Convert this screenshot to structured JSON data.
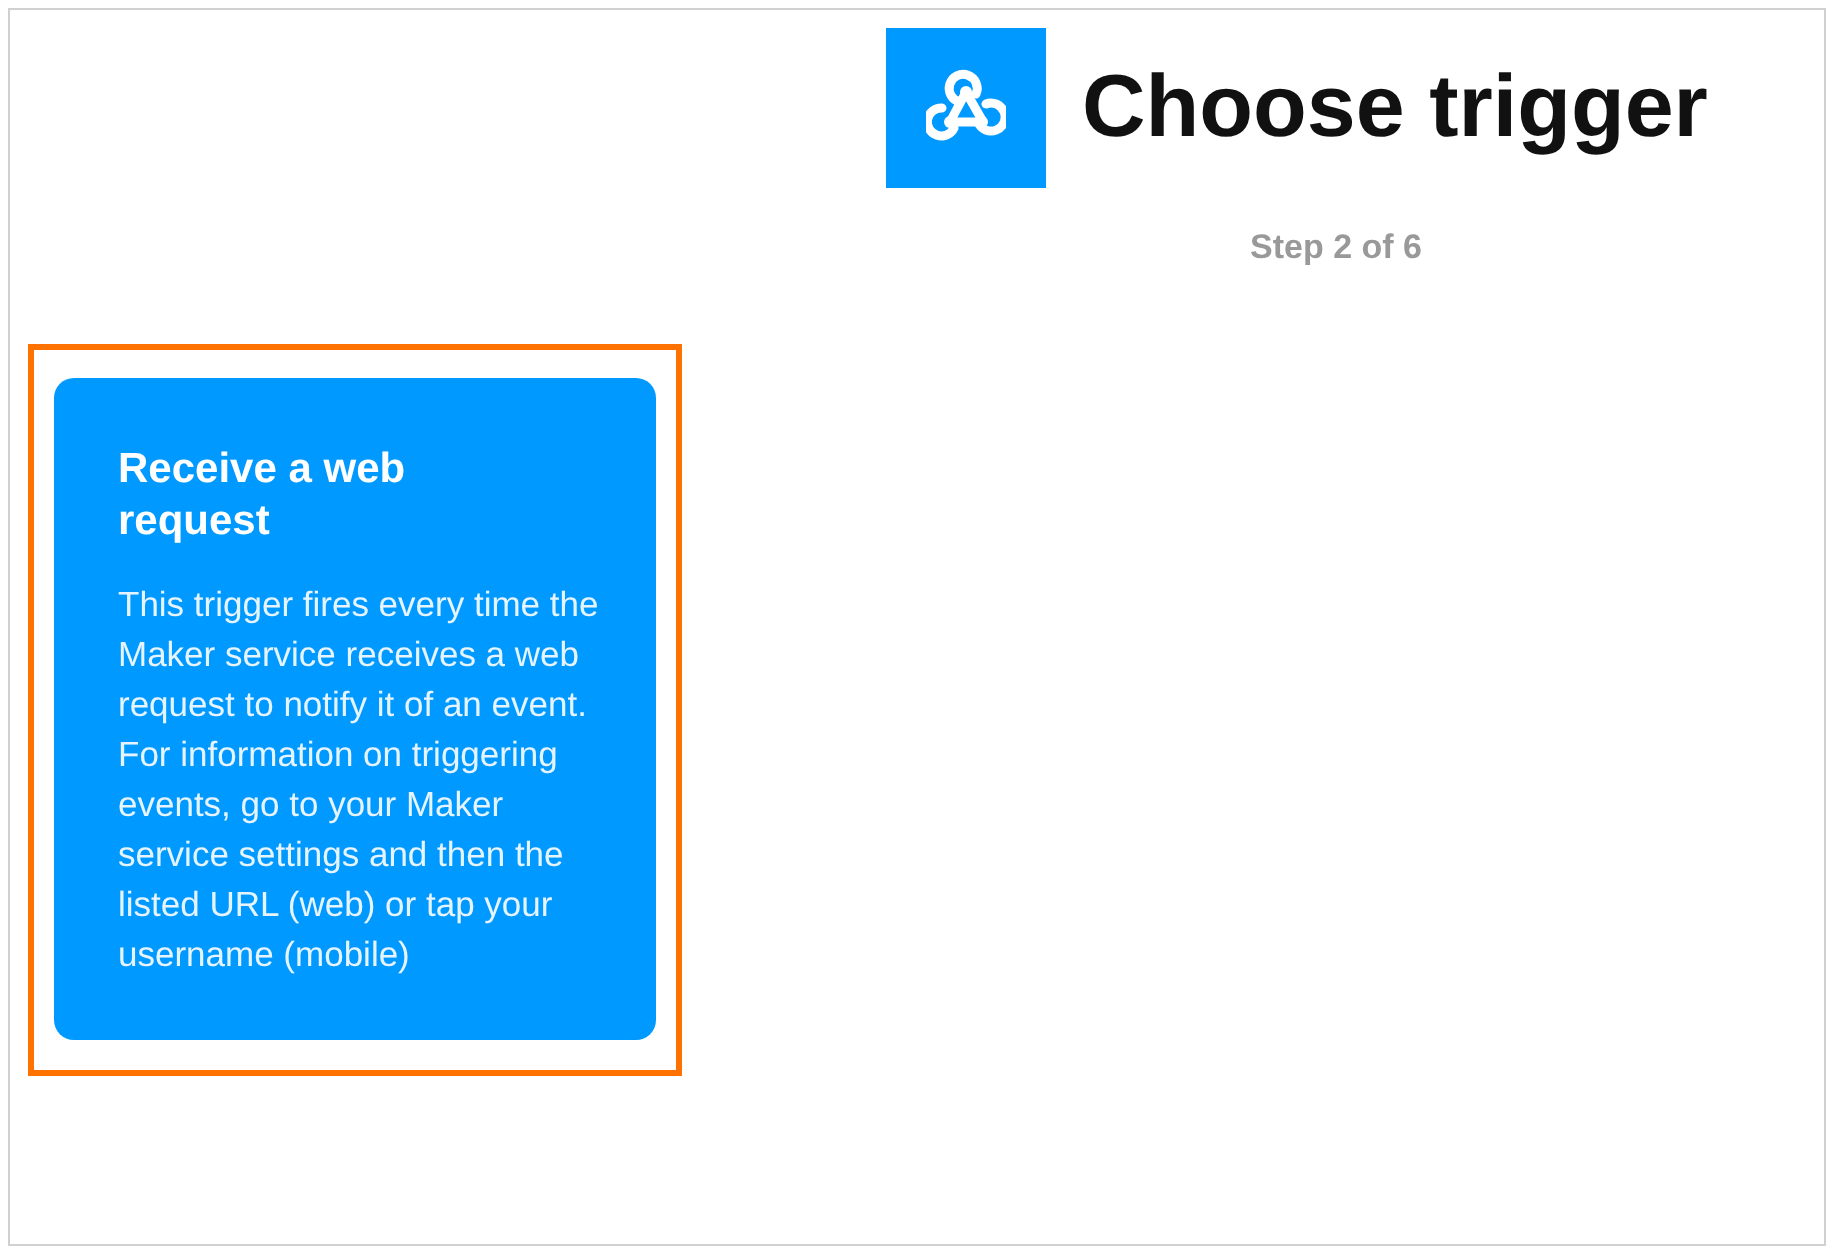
{
  "header": {
    "title": "Choose trigger",
    "step": "Step 2 of 6"
  },
  "triggers": [
    {
      "title": "Receive a web request",
      "description": "This trigger fires every time the Maker service receives a web request to notify it of an event. For information on triggering events, go to your Maker service settings and then the listed URL (web) or tap your username (mobile)",
      "selected": true
    }
  ]
}
